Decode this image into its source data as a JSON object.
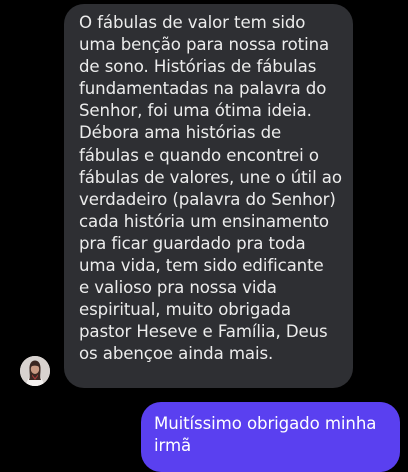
{
  "conversation": {
    "incoming": {
      "lines": [
        "O fábulas de valor tem sido",
        "uma benção para nossa rotina",
        "de sono. Histórias de fábulas",
        "fundamentadas na palavra do",
        "Senhor, foi uma ótima ideia.",
        "Débora ama histórias de",
        "fábulas e quando encontrei o",
        "fábulas de valores, une o útil ao",
        "verdadeiro (palavra do Senhor)",
        "cada história um ensinamento",
        "pra ficar guardado pra toda",
        "uma vida, tem sido edificante",
        "e valioso pra nossa vida",
        "espiritual, muito obrigada",
        "pastor Heseve e Família, Deus",
        "os abençoe ainda mais."
      ],
      "avatar_icon": "user-avatar-photo"
    },
    "outgoing": {
      "lines": [
        "Muitíssimo obrigado minha",
        "irmã"
      ]
    }
  },
  "colors": {
    "background": "#000000",
    "incoming_bubble": "#2e2f33",
    "outgoing_bubble": "#5a40f0"
  }
}
